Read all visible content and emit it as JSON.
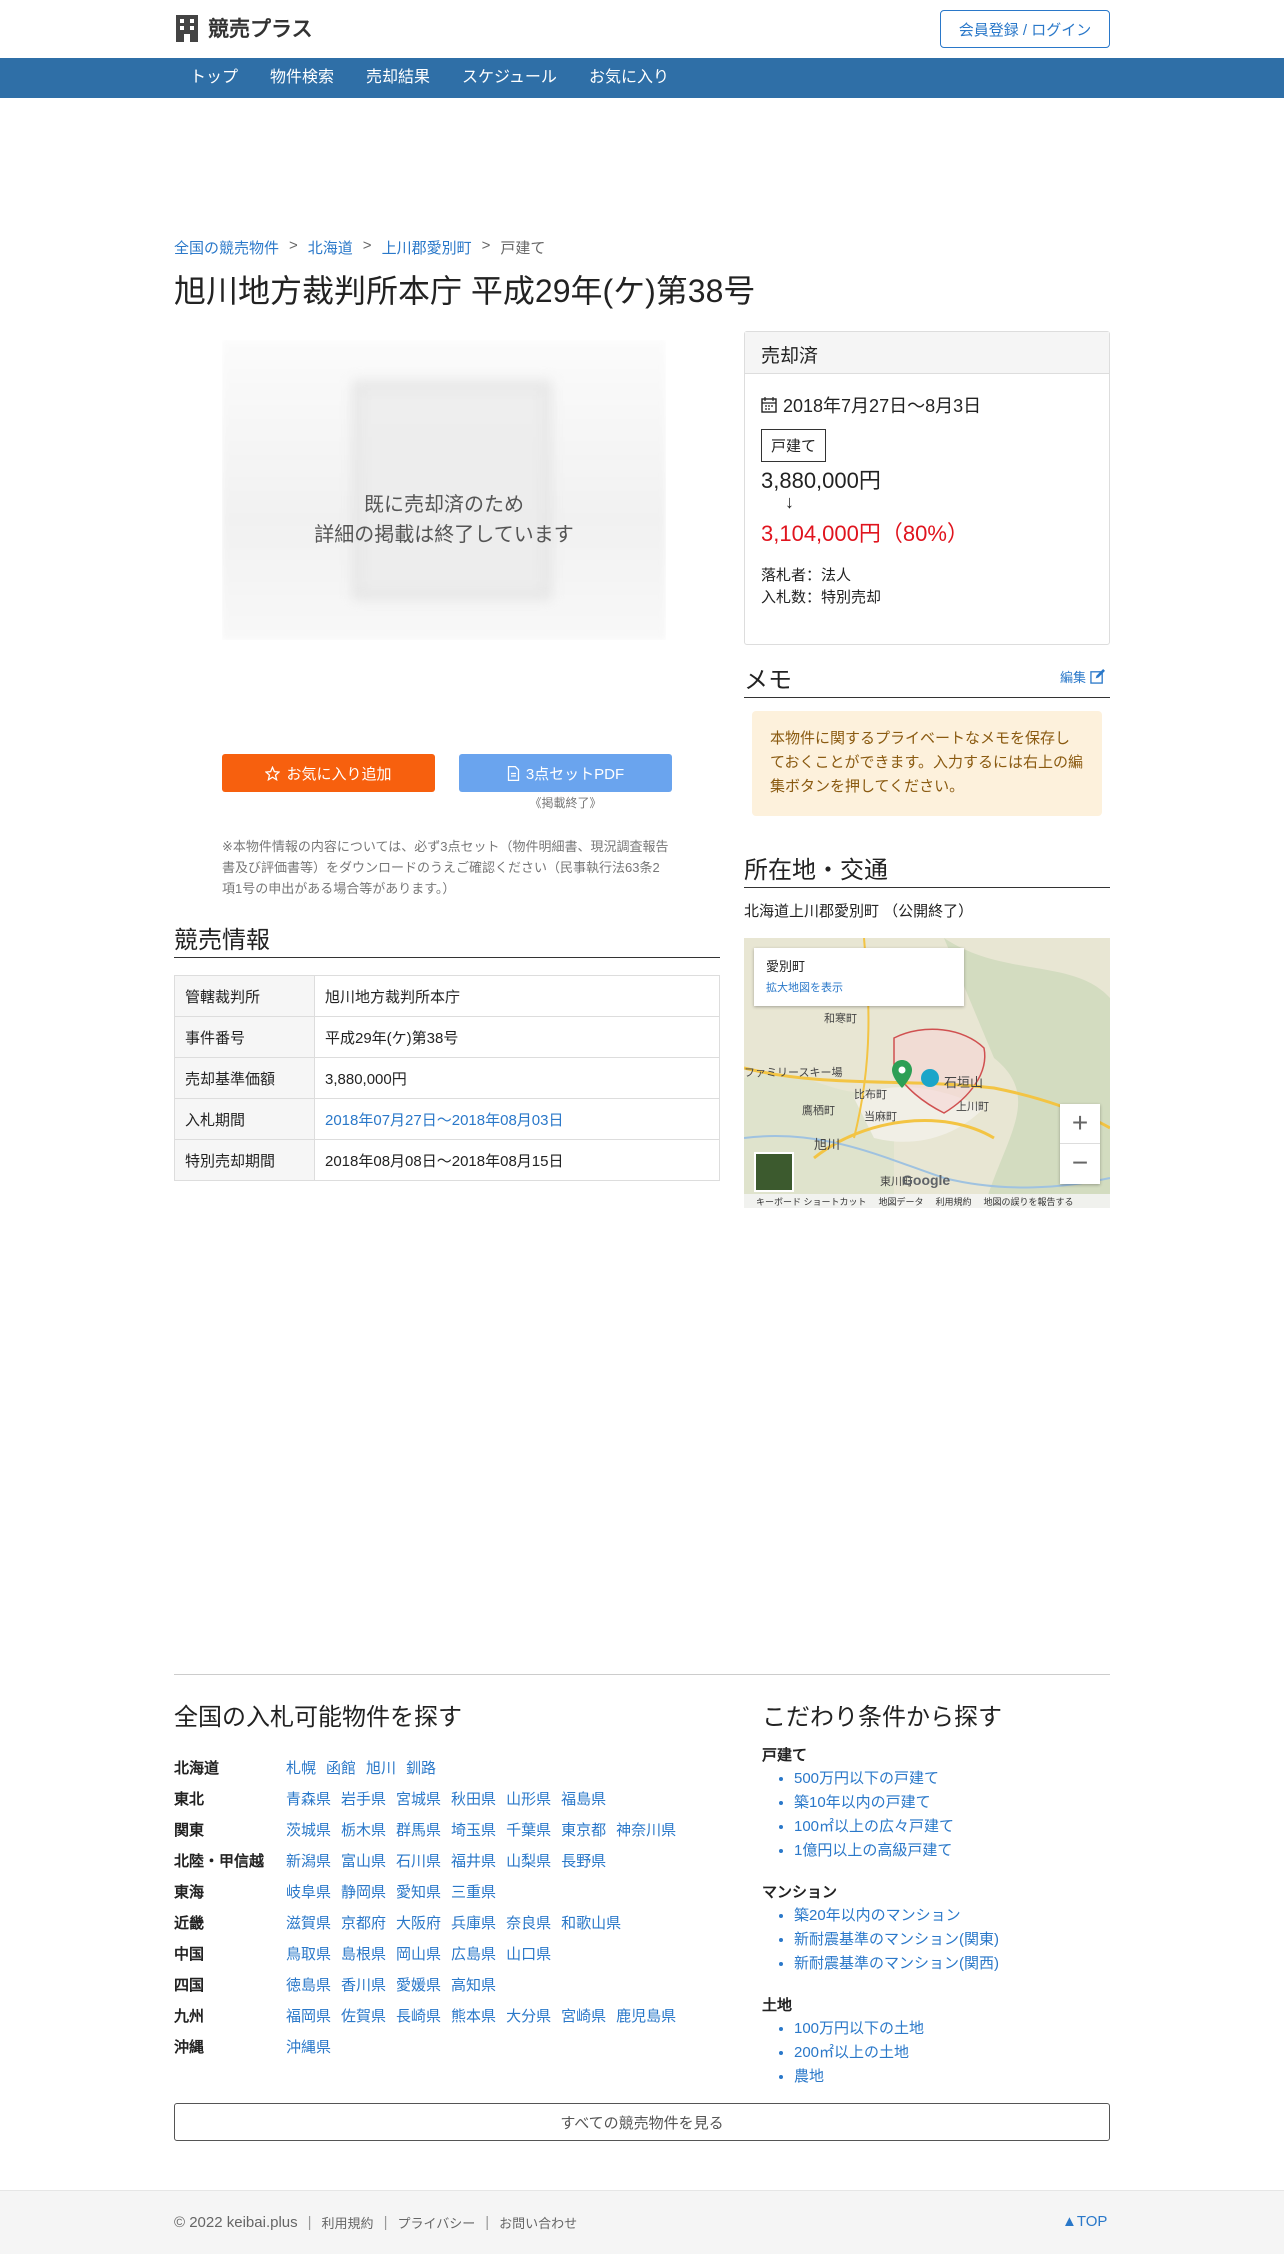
{
  "header": {
    "logo_text": "競売プラス",
    "login_label": "会員登録 / ログイン"
  },
  "nav": {
    "items": [
      {
        "label": "トップ"
      },
      {
        "label": "物件検索"
      },
      {
        "label": "売却結果"
      },
      {
        "label": "スケジュール"
      },
      {
        "label": "お気に入り"
      }
    ]
  },
  "breadcrumb": {
    "items": [
      {
        "label": "全国の競売物件"
      },
      {
        "label": "北海道"
      },
      {
        "label": "上川郡愛別町"
      },
      {
        "label": "戸建て"
      }
    ],
    "separator": ">"
  },
  "page_title": "旭川地方裁判所本庁 平成29年(ケ)第38号",
  "photo": {
    "message_line1": "既に売却済のため",
    "message_line2": "詳細の掲載は終了しています"
  },
  "buttons": {
    "favorite_label": "お気に入り追加",
    "pdf_label": "3点セットPDF",
    "pdf_note": "《掲載終了》"
  },
  "notice": "※本物件情報の内容については、必ず3点セット（物件明細書、現況調査報告書及び評価書等）をダウンロードのうえご確認ください（民事執行法63条2項1号の申出がある場合等があります。）",
  "auction_info": {
    "title": "競売情報",
    "rows": [
      {
        "key": "管轄裁判所",
        "value": "旭川地方裁判所本庁",
        "link": false
      },
      {
        "key": "事件番号",
        "value": "平成29年(ケ)第38号",
        "link": false
      },
      {
        "key": "売却基準価額",
        "value": "3,880,000円",
        "link": false
      },
      {
        "key": "入札期間",
        "value": "2018年07月27日〜2018年08月03日",
        "link": true
      },
      {
        "key": "特別売却期間",
        "value": "2018年08月08日〜2018年08月15日",
        "link": false
      }
    ]
  },
  "sold": {
    "status": "売却済",
    "date_range": "2018年7月27日〜8月3日",
    "type": "戸建て",
    "base_price": "3,880,000円",
    "arrow": "↓",
    "final_price": "3,104,000円（80%）",
    "buyer": "落札者：法人",
    "bid_count": "入札数：特別売却"
  },
  "memo": {
    "title": "メモ",
    "edit_label": "編集",
    "text": "本物件に関するプライベートなメモを保存しておくことができます。入力するには右上の編集ボタンを押してください。"
  },
  "location": {
    "title": "所在地・交通",
    "address": "北海道上川郡愛別町 （公開終了）",
    "map_place": "愛別町",
    "map_link": "拡大地図を表示",
    "map_labels": {
      "a": "和寒町",
      "b": "ファミリースキー場",
      "c": "比布町",
      "d": "石垣山",
      "e": "鷹栖町",
      "f": "当麻町",
      "g": "上川町",
      "h": "旭川",
      "i": "東川町"
    },
    "map_footer": [
      "キーボード ショートカット",
      "地図データ",
      "利用規約",
      "地図の誤りを報告する"
    ],
    "zoom_in": "+",
    "zoom_out": "−",
    "google": "Google"
  },
  "search_regions": {
    "title": "全国の入札可能物件を探す",
    "regions": [
      {
        "name": "北海道",
        "prefs": [
          "札幌",
          "函館",
          "旭川",
          "釧路"
        ]
      },
      {
        "name": "東北",
        "prefs": [
          "青森県",
          "岩手県",
          "宮城県",
          "秋田県",
          "山形県",
          "福島県"
        ]
      },
      {
        "name": "関東",
        "prefs": [
          "茨城県",
          "栃木県",
          "群馬県",
          "埼玉県",
          "千葉県",
          "東京都",
          "神奈川県"
        ]
      },
      {
        "name": "北陸・甲信越",
        "prefs": [
          "新潟県",
          "富山県",
          "石川県",
          "福井県",
          "山梨県",
          "長野県"
        ]
      },
      {
        "name": "東海",
        "prefs": [
          "岐阜県",
          "静岡県",
          "愛知県",
          "三重県"
        ]
      },
      {
        "name": "近畿",
        "prefs": [
          "滋賀県",
          "京都府",
          "大阪府",
          "兵庫県",
          "奈良県",
          "和歌山県"
        ]
      },
      {
        "name": "中国",
        "prefs": [
          "鳥取県",
          "島根県",
          "岡山県",
          "広島県",
          "山口県"
        ]
      },
      {
        "name": "四国",
        "prefs": [
          "徳島県",
          "香川県",
          "愛媛県",
          "高知県"
        ]
      },
      {
        "name": "九州",
        "prefs": [
          "福岡県",
          "佐賀県",
          "長崎県",
          "熊本県",
          "大分県",
          "宮崎県",
          "鹿児島県"
        ]
      },
      {
        "name": "沖縄",
        "prefs": [
          "沖縄県"
        ]
      }
    ]
  },
  "conditions": {
    "title": "こだわり条件から探す",
    "groups": [
      {
        "name": "戸建て",
        "items": [
          "500万円以下の戸建て",
          "築10年以内の戸建て",
          "100㎡以上の広々戸建て",
          "1億円以上の高級戸建て"
        ]
      },
      {
        "name": "マンション",
        "items": [
          "築20年以内のマンション",
          "新耐震基準のマンション(関東)",
          "新耐震基準のマンション(関西)"
        ]
      },
      {
        "name": "土地",
        "items": [
          "100万円以下の土地",
          "200㎡以上の土地",
          "農地"
        ]
      }
    ]
  },
  "all_button": "すべての競売物件を見る",
  "footer": {
    "copyright": "© 2022 keibai.plus",
    "links": [
      "利用規約",
      "プライバシー",
      "お問い合わせ"
    ],
    "top_label": "▲TOP"
  },
  "colors": {
    "nav_bg": "#2f6fa7",
    "link": "#2a78c9",
    "favorite_btn": "#f7600e",
    "pdf_btn": "#6aa4ee",
    "final_price": "#e0141e",
    "memo_bg": "#fdf1dc"
  }
}
